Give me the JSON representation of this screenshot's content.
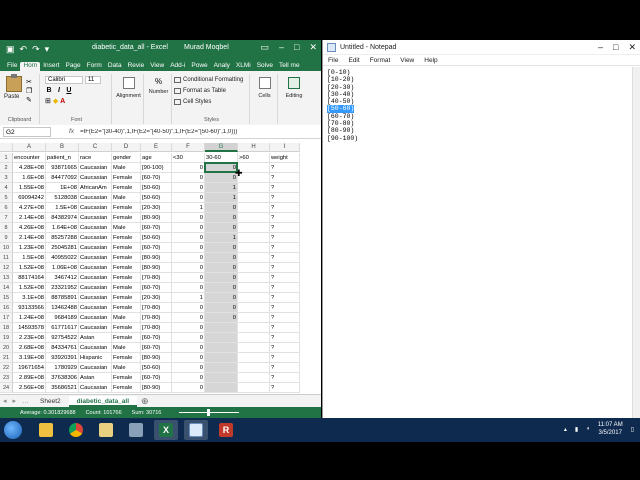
{
  "excel": {
    "title_doc": "diabetic_data_all  -  Excel",
    "title_user": "Murad Moqbel",
    "tabs": [
      "File",
      "Hom",
      "Insert",
      "Page",
      "Form",
      "Data",
      "Revie",
      "View",
      "Add-i",
      "Powe",
      "Analy",
      "XLMi",
      "Solve",
      "Tell me"
    ],
    "active_tab": "Hom",
    "ribbon": {
      "paste": "Paste",
      "clipboard": "Clipboard",
      "font_name": "Calibri",
      "font_size": "11",
      "font_label": "Font",
      "alignment": "Alignment",
      "number": "Number",
      "cond_fmt": "Conditional Formatting",
      "format_table": "Format as Table",
      "cell_styles": "Cell Styles",
      "styles_label": "Styles",
      "cells": "Cells",
      "editing": "Editing"
    },
    "name_box": "G2",
    "fx": "fx",
    "formula": "=IF(E2=\"[30-40)\",1,IF(E2=\"[40-50)\",1,IF(E2=\"[50-60)\",1,0)))",
    "columns": [
      "A",
      "B",
      "C",
      "D",
      "E",
      "F",
      "G",
      "H",
      "I"
    ],
    "headers": [
      "encounter",
      "patient_n",
      "race",
      "gender",
      "age",
      "<30",
      "30-60",
      ">60",
      "weight"
    ],
    "rows": [
      [
        "4.28E+08",
        "93871665",
        "Caucasian",
        "Male",
        "[90-100)",
        "0",
        "0",
        "",
        "?"
      ],
      [
        "1.6E+08",
        "84477092",
        "Caucasian",
        "Female",
        "[60-70)",
        "0",
        "0",
        "",
        "?"
      ],
      [
        "1.55E+08",
        "1E+08",
        "AfricanAm",
        "Female",
        "[50-60)",
        "0",
        "1",
        "",
        "?"
      ],
      [
        "69094242",
        "5128038",
        "Caucasian",
        "Male",
        "[50-60)",
        "0",
        "1",
        "",
        "?"
      ],
      [
        "4.27E+08",
        "1.5E+08",
        "Caucasian",
        "Female",
        "[20-30)",
        "1",
        "0",
        "",
        "?"
      ],
      [
        "2.14E+08",
        "84382974",
        "Caucasian",
        "Female",
        "[80-90)",
        "0",
        "0",
        "",
        "?"
      ],
      [
        "4.26E+08",
        "1.64E+08",
        "Caucasian",
        "Male",
        "[60-70)",
        "0",
        "0",
        "",
        "?"
      ],
      [
        "2.14E+08",
        "85257288",
        "Caucasian",
        "Female",
        "[50-60)",
        "0",
        "1",
        "",
        "?"
      ],
      [
        "1.23E+08",
        "25045281",
        "Caucasian",
        "Female",
        "[60-70)",
        "0",
        "0",
        "",
        "?"
      ],
      [
        "1.5E+08",
        "40955022",
        "Caucasian",
        "Female",
        "[80-90)",
        "0",
        "0",
        "",
        "?"
      ],
      [
        "1.52E+08",
        "1.06E+08",
        "Caucasian",
        "Female",
        "[80-90)",
        "0",
        "0",
        "",
        "?"
      ],
      [
        "88174164",
        "3467412",
        "Caucasian",
        "Female",
        "[70-80)",
        "0",
        "0",
        "",
        "?"
      ],
      [
        "1.52E+08",
        "23321952",
        "Caucasian",
        "Female",
        "[60-70)",
        "0",
        "0",
        "",
        "?"
      ],
      [
        "3.1E+08",
        "88785891",
        "Caucasian",
        "Female",
        "[20-30)",
        "1",
        "0",
        "",
        "?"
      ],
      [
        "93133566",
        "13462488",
        "Caucasian",
        "Female",
        "[70-80)",
        "0",
        "0",
        "",
        "?"
      ],
      [
        "1.24E+08",
        "9684189",
        "Caucasian",
        "Male",
        "[70-80)",
        "0",
        "0",
        "",
        "?"
      ],
      [
        "14593578",
        "61771617",
        "Caucasian",
        "Female",
        "[70-80)",
        "0",
        "",
        "",
        "?"
      ],
      [
        "2.23E+08",
        "92754522",
        "Asian",
        "Female",
        "[60-70)",
        "0",
        "",
        "",
        "?"
      ],
      [
        "2.68E+08",
        "84334761",
        "Caucasian",
        "Male",
        "[60-70)",
        "0",
        "",
        "",
        "?"
      ],
      [
        "3.19E+08",
        "93920391",
        "Hispanic",
        "Female",
        "[80-90)",
        "0",
        "",
        "",
        "?"
      ],
      [
        "19671654",
        "1780929",
        "Caucasian",
        "Male",
        "[50-60)",
        "0",
        "",
        "",
        "?"
      ],
      [
        "2.89E+08",
        "37638306",
        "Asian",
        "Female",
        "[60-70)",
        "0",
        "",
        "",
        "?"
      ],
      [
        "2.56E+08",
        "35686521",
        "Caucasian",
        "Female",
        "[80-90)",
        "0",
        "",
        "",
        "?"
      ]
    ],
    "sheets": [
      "Sheet2",
      "diabetic_data_all"
    ],
    "active_sheet": "diabetic_data_all",
    "status": {
      "average": "Average: 0.301829688",
      "count": "Count: 101766",
      "sum": "Sum: 30716"
    }
  },
  "notepad": {
    "title": "Untitled - Notepad",
    "menu": [
      "File",
      "Edit",
      "Format",
      "View",
      "Help"
    ],
    "lines": [
      "[0-10)",
      "[10-20)",
      "[20-30)",
      "[30-40)",
      "[40-50)",
      "[50-60)",
      "[60-70)",
      "[70-80)",
      "[80-90)",
      "[90-100)"
    ],
    "highlighted_index": 5
  },
  "taskbar": {
    "time": "11:07 AM",
    "date": "3/5/2017"
  }
}
